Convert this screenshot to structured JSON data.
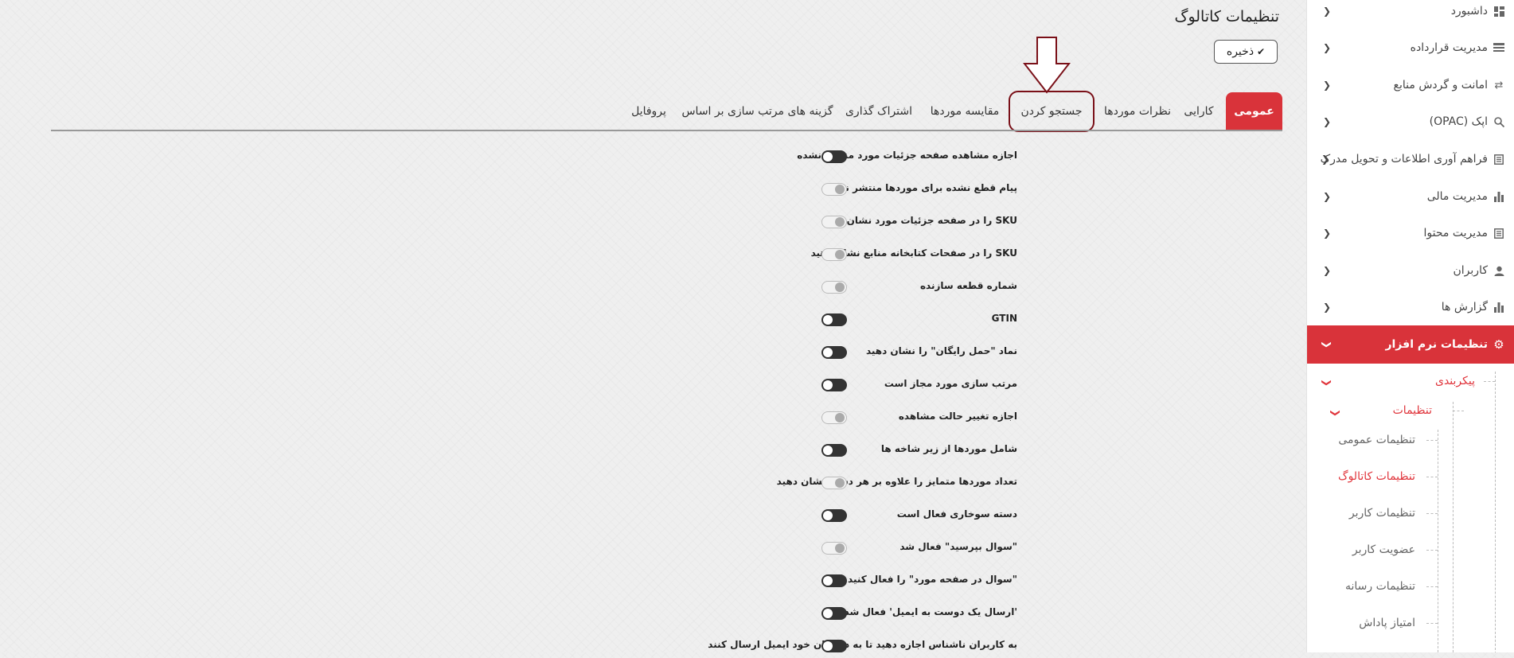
{
  "sidebar": {
    "items": [
      {
        "label": "داشبورد",
        "icon": "dashboard-icon"
      },
      {
        "label": "مدیریت قرارداده",
        "icon": "contract-icon"
      },
      {
        "label": "امانت و گردش منابع",
        "icon": "circulation-icon"
      },
      {
        "label": "اپک (OPAC)",
        "icon": "search-icon"
      },
      {
        "label": "فراهم آوری اطلاعات و تحویل مدرک",
        "icon": "document-icon"
      },
      {
        "label": "مدیریت مالی",
        "icon": "chart-icon"
      },
      {
        "label": "مدیریت محتوا",
        "icon": "content-icon"
      },
      {
        "label": "کاربران",
        "icon": "user-icon"
      },
      {
        "label": "گزارش ها",
        "icon": "report-icon"
      },
      {
        "label": "تنظیمات نرم افزار",
        "icon": "gear-icon"
      }
    ],
    "config_label": "پیکربندی",
    "settings_label": "تنظیمات",
    "sub_items": [
      "تنظیمات عمومی",
      "تنظیمات کاتالوگ",
      "تنظیمات کاربر",
      "عضویت کاربر",
      "تنظیمات رسانه",
      "امتیاز پاداش"
    ],
    "active_color": "#d9333a"
  },
  "header": {
    "title": "تنظیمات کاتالوگ",
    "save_label": "ذخیره"
  },
  "tabs": [
    "عمومی",
    "کارایی",
    "نظرات موردها",
    "جستجو کردن",
    "مقایسه موردها",
    "اشتراک گذاری",
    "گزینه های مرتب سازی بر اساس",
    "پروفایل"
  ],
  "settings": [
    {
      "label": "اجازه مشاهده صفحه جزئیات مورد منتشر نشده",
      "enabled": true
    },
    {
      "label": "پیام قطع نشده برای موردها منتشر نشده",
      "enabled": false
    },
    {
      "label": "SKU را در صفحه جزئیات مورد نشان دهید",
      "enabled": false
    },
    {
      "label": "SKU را در صفحات کتابخانه منابع نشان دهید",
      "enabled": false
    },
    {
      "label": "شماره قطعه سازنده",
      "enabled": false
    },
    {
      "label": "GTIN",
      "enabled": true
    },
    {
      "label": "نماد \"حمل رایگان\" را نشان دهید",
      "enabled": true
    },
    {
      "label": "مرتب سازی مورد مجاز است",
      "enabled": true
    },
    {
      "label": "اجازه تغییر حالت مشاهده",
      "enabled": false
    },
    {
      "label": "شامل موردها از زیر شاخه ها",
      "enabled": true
    },
    {
      "label": "تعداد موردها متمایز را علاوه بر هر دسته نشان دهید",
      "enabled": false
    },
    {
      "label": "دسته سوخاری فعال است",
      "enabled": true
    },
    {
      "label": "\"سوال بپرسید\" فعال شد",
      "enabled": false
    },
    {
      "label": "\"سوال در صفحه مورد\" را فعال کنید",
      "enabled": true
    },
    {
      "label": "'ارسال یک دوست به ایمیل' فعال شد",
      "enabled": true
    },
    {
      "label": "به کاربران ناشناس اجازه دهید تا به دوستان خود ایمیل ارسال کنند",
      "enabled": true
    }
  ]
}
